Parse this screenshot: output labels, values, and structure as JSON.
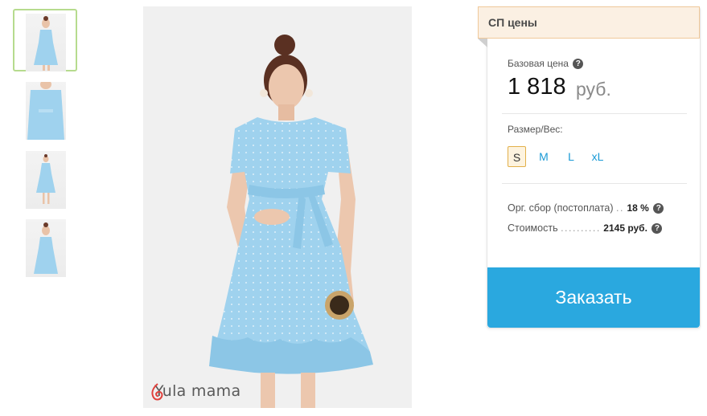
{
  "gallery": {
    "thumbnails": [
      {
        "label": "Фото 1",
        "active": true
      },
      {
        "label": "Фото 2",
        "active": false
      },
      {
        "label": "Фото 3",
        "active": false
      },
      {
        "label": "Фото 4",
        "active": false
      }
    ],
    "brand": "Yula mama"
  },
  "panel": {
    "ribbon_title": "СП цены",
    "base_price_label": "Базовая цена",
    "price": "1 818",
    "currency": "руб.",
    "size_label": "Размер/Вес:",
    "sizes": [
      "S",
      "M",
      "L",
      "xL"
    ],
    "selected_size": "S",
    "org_fee_label": "Орг. сбор (постоплата)",
    "org_fee_value": "18 %",
    "cost_label": "Стоимость",
    "cost_value": "2145 руб.",
    "order_button": "Заказать"
  },
  "colors": {
    "accent_blue": "#2aa8df",
    "ribbon_bg": "#fbf0e3",
    "selected_size_border": "#e2b04a",
    "thumb_active_border": "#b6db8e",
    "dress": "#9fd2ee"
  }
}
